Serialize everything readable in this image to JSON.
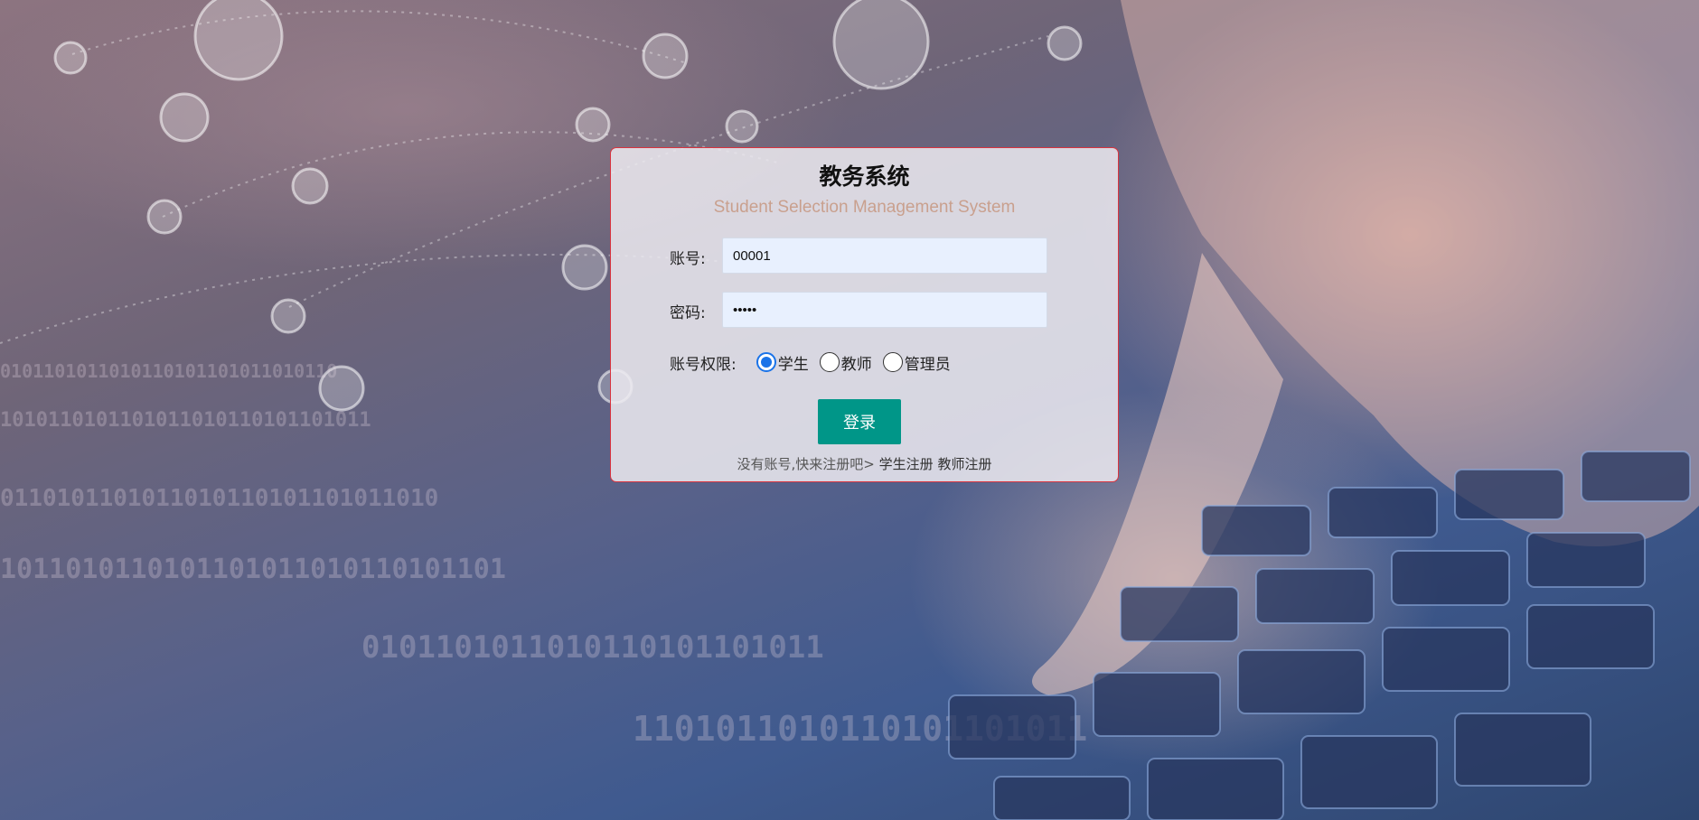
{
  "login": {
    "title": "教务系统",
    "subtitle": "Student Selection Management System",
    "account_label": "账号:",
    "account_value": "00001",
    "password_label": "密码:",
    "password_value": "•••••",
    "role_label": "账号权限:",
    "roles": [
      {
        "label": "学生",
        "checked": true
      },
      {
        "label": "教师",
        "checked": false
      },
      {
        "label": "管理员",
        "checked": false
      }
    ],
    "login_button": "登录",
    "register_prompt": "没有账号,快来注册吧>",
    "student_register": "学生注册",
    "teacher_register": "教师注册"
  },
  "colors": {
    "primary_button": "#009688",
    "card_border": "#d9343f",
    "subtitle": "#c9a08e",
    "input_bg": "#e8f0fe",
    "radio_checked": "#1a73e8"
  }
}
